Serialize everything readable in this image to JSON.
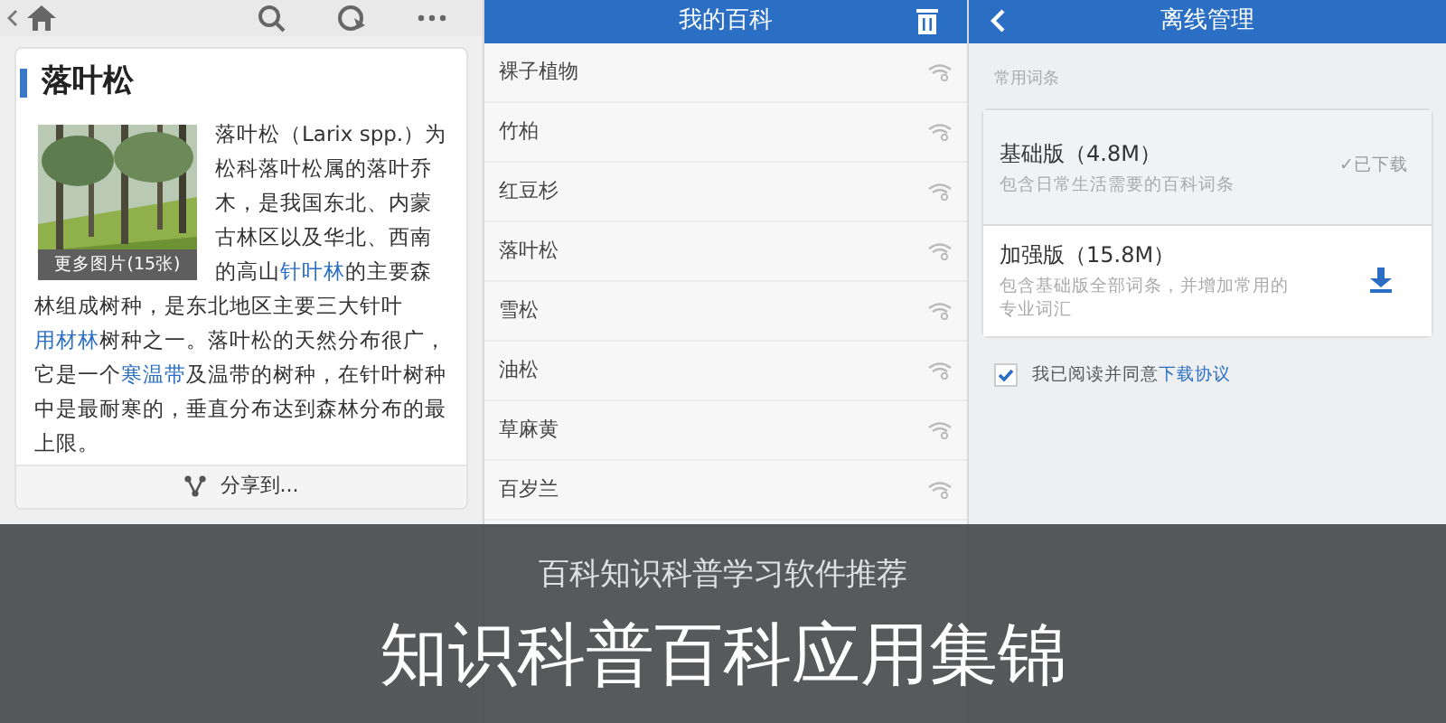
{
  "article_screen": {
    "title": "落叶松",
    "image_caption": "更多图片(15张)",
    "paragraph": [
      {
        "text": "落叶松（Larix spp.）为松科落叶松属的落叶乔木，是我国东北、内蒙古林区以及华北、西南的高山",
        "link": false
      },
      {
        "text": "针叶林",
        "link": true
      },
      {
        "text": "的主要森林组成树种，是东北地区主要三大针叶",
        "link": false
      },
      {
        "text": "用材林",
        "link": true
      },
      {
        "text": "树种之一。落叶松的天然分布很广，它是一个",
        "link": false
      },
      {
        "text": "寒温带",
        "link": true
      },
      {
        "text": "及温带的树种，在针叶树种中是最耐寒的，垂直分布达到森林分布的最上限。",
        "link": false
      }
    ],
    "share": "分享到..."
  },
  "my_encyclopedia": {
    "title": "我的百科",
    "items": [
      {
        "label": "裸子植物"
      },
      {
        "label": "竹柏"
      },
      {
        "label": "红豆杉"
      },
      {
        "label": "落叶松"
      },
      {
        "label": "雪松"
      },
      {
        "label": "油松"
      },
      {
        "label": "草麻黄"
      },
      {
        "label": "百岁兰"
      }
    ]
  },
  "offline": {
    "title": "离线管理",
    "section": "常用词条",
    "packages": [
      {
        "name": "基础版（4.8M）",
        "description": "包含日常生活需要的百科词条",
        "downloaded": true,
        "status": "✓已下载"
      },
      {
        "name": "加强版（15.8M）",
        "description": "包含基础版全部词条，并增加常用的专业词汇",
        "downloaded": false
      }
    ],
    "agreement": {
      "checked": true,
      "text": "我已阅读并同意",
      "link": "下载协议"
    }
  },
  "caption": {
    "subtitle": "百科知识科普学习软件推荐",
    "title": "知识科普百科应用集锦"
  }
}
